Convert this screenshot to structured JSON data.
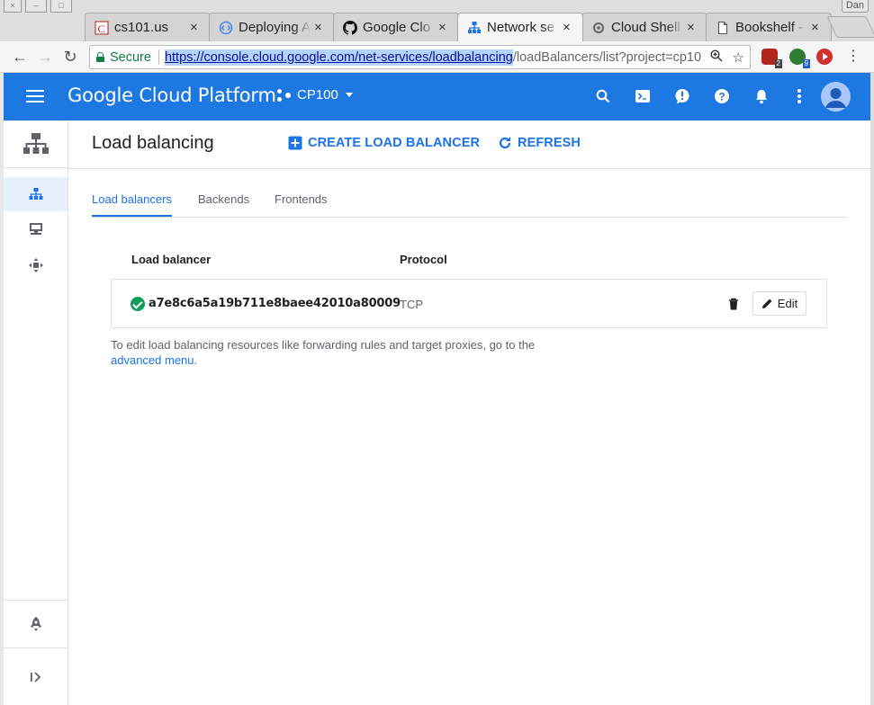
{
  "browser": {
    "window_controls": [
      "×",
      "–",
      "□"
    ],
    "profile": "Dan",
    "tabs": [
      {
        "title": "cs101.us",
        "icon": "cs101-favicon",
        "close": "×",
        "active": false
      },
      {
        "title": "Deploying A",
        "icon": "code-favicon",
        "close": "×",
        "active": false
      },
      {
        "title": "Google Clo",
        "icon": "github-icon",
        "close": "×",
        "active": false
      },
      {
        "title": "Network se",
        "icon": "network-services-icon",
        "close": "×",
        "active": true
      },
      {
        "title": "Cloud Shell",
        "icon": "cloud-shell-icon",
        "close": "×",
        "active": false
      },
      {
        "title": "Bookshelf -",
        "icon": "page-icon",
        "close": "×",
        "active": false
      }
    ],
    "secure_label": "Secure",
    "url_highlight": "https://console.cloud.google.com/net-services/loadbalancing",
    "url_rest": "/loadBalancers/list?project=cp10",
    "extensions": [
      {
        "name": "ublock-extension",
        "badge": "2",
        "color": "#b3261e"
      },
      {
        "name": "green-extension",
        "badge": "9",
        "color": "#2e7d32"
      },
      {
        "name": "red-play-extension",
        "badge": "",
        "color": "#d32f2f"
      }
    ]
  },
  "header": {
    "title": "Google Cloud Platform",
    "project": "CP100",
    "brand_color": "#1e78e2"
  },
  "page": {
    "title": "Load balancing",
    "create_label": "CREATE LOAD BALANCER",
    "refresh_label": "REFRESH",
    "tabs": [
      {
        "label": "Load balancers",
        "active": true
      },
      {
        "label": "Backends",
        "active": false
      },
      {
        "label": "Frontends",
        "active": false
      }
    ],
    "table": {
      "columns": [
        "Load balancer",
        "Protocol"
      ],
      "rows": [
        {
          "name": "a7e8c6a5a19b711e8baee42010a80009",
          "protocol": "TCP",
          "status": "ok"
        }
      ],
      "edit_label": "Edit"
    },
    "note_text": "To edit load balancing resources like forwarding rules and target proxies, go to the",
    "note_link": "advanced menu",
    "note_end": "."
  }
}
